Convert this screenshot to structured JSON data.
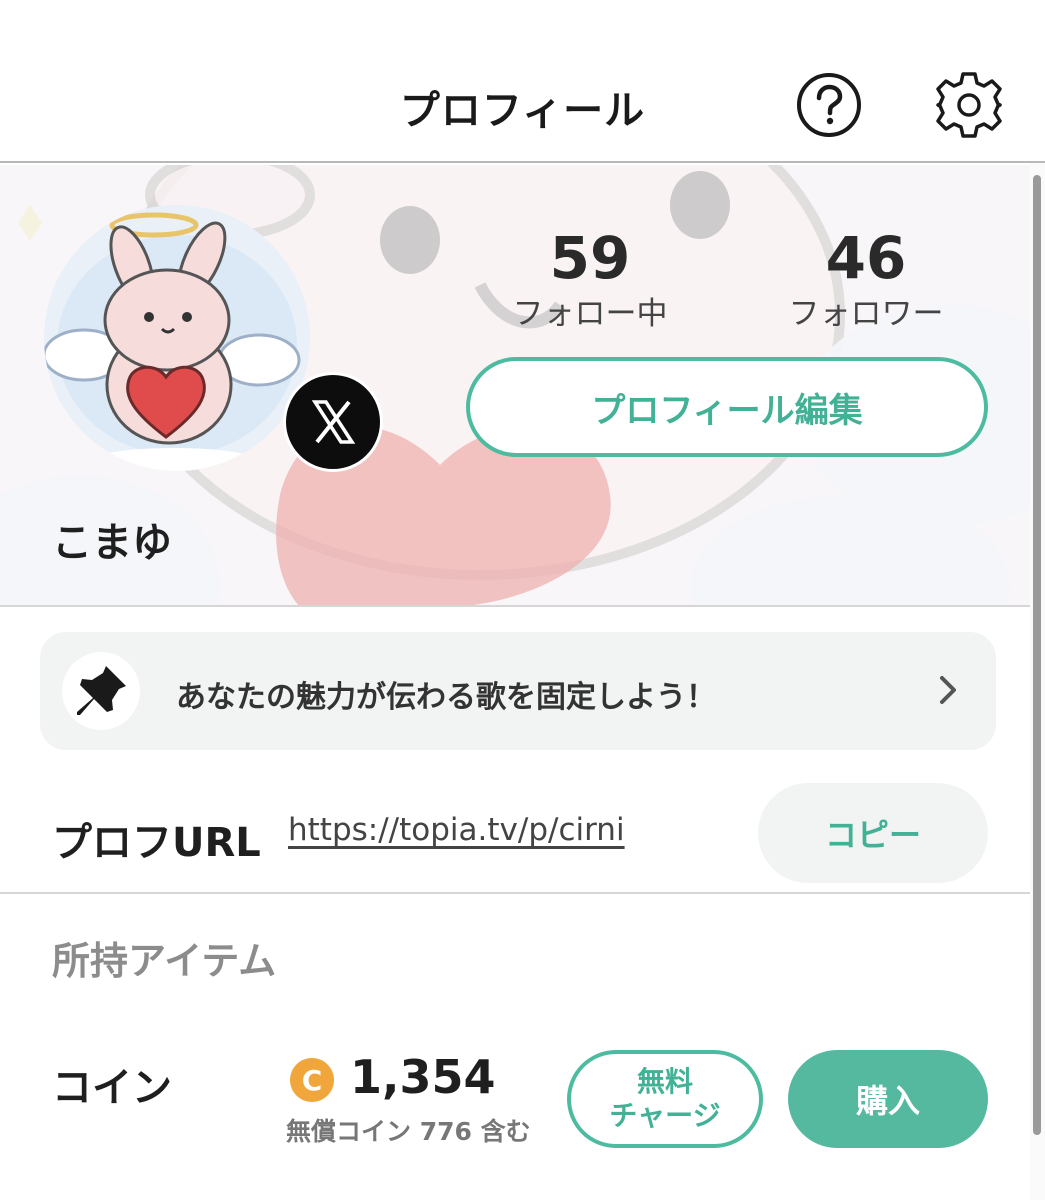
{
  "header": {
    "title": "プロフィール",
    "help_icon": "question-circle-icon",
    "settings_icon": "gear-icon"
  },
  "profile": {
    "following_count": "59",
    "following_label": "フォロー中",
    "followers_count": "46",
    "followers_label": "フォロワー",
    "edit_button": "プロフィール編集",
    "username": "こまゆ",
    "social_badge": "x-logo-icon"
  },
  "pin_banner": {
    "text": "あなたの魅力が伝わる歌を固定しよう！",
    "icon": "pushpin-icon"
  },
  "profile_url": {
    "label": "プロフURL",
    "url": "https://topia.tv/p/cirni",
    "copy_button": "コピー"
  },
  "items": {
    "heading": "所持アイテム",
    "coin_label": "コイン",
    "coin_icon_letter": "C",
    "coin_amount": "1,354",
    "coin_note": "無償コイン 776 含む",
    "free_charge_line1": "無料",
    "free_charge_line2": "チャージ",
    "buy_button": "購入"
  },
  "colors": {
    "accent": "#4dbba0",
    "accent_text": "#43b195",
    "coin": "#f0a63b",
    "panel": "#f2f3f3"
  }
}
